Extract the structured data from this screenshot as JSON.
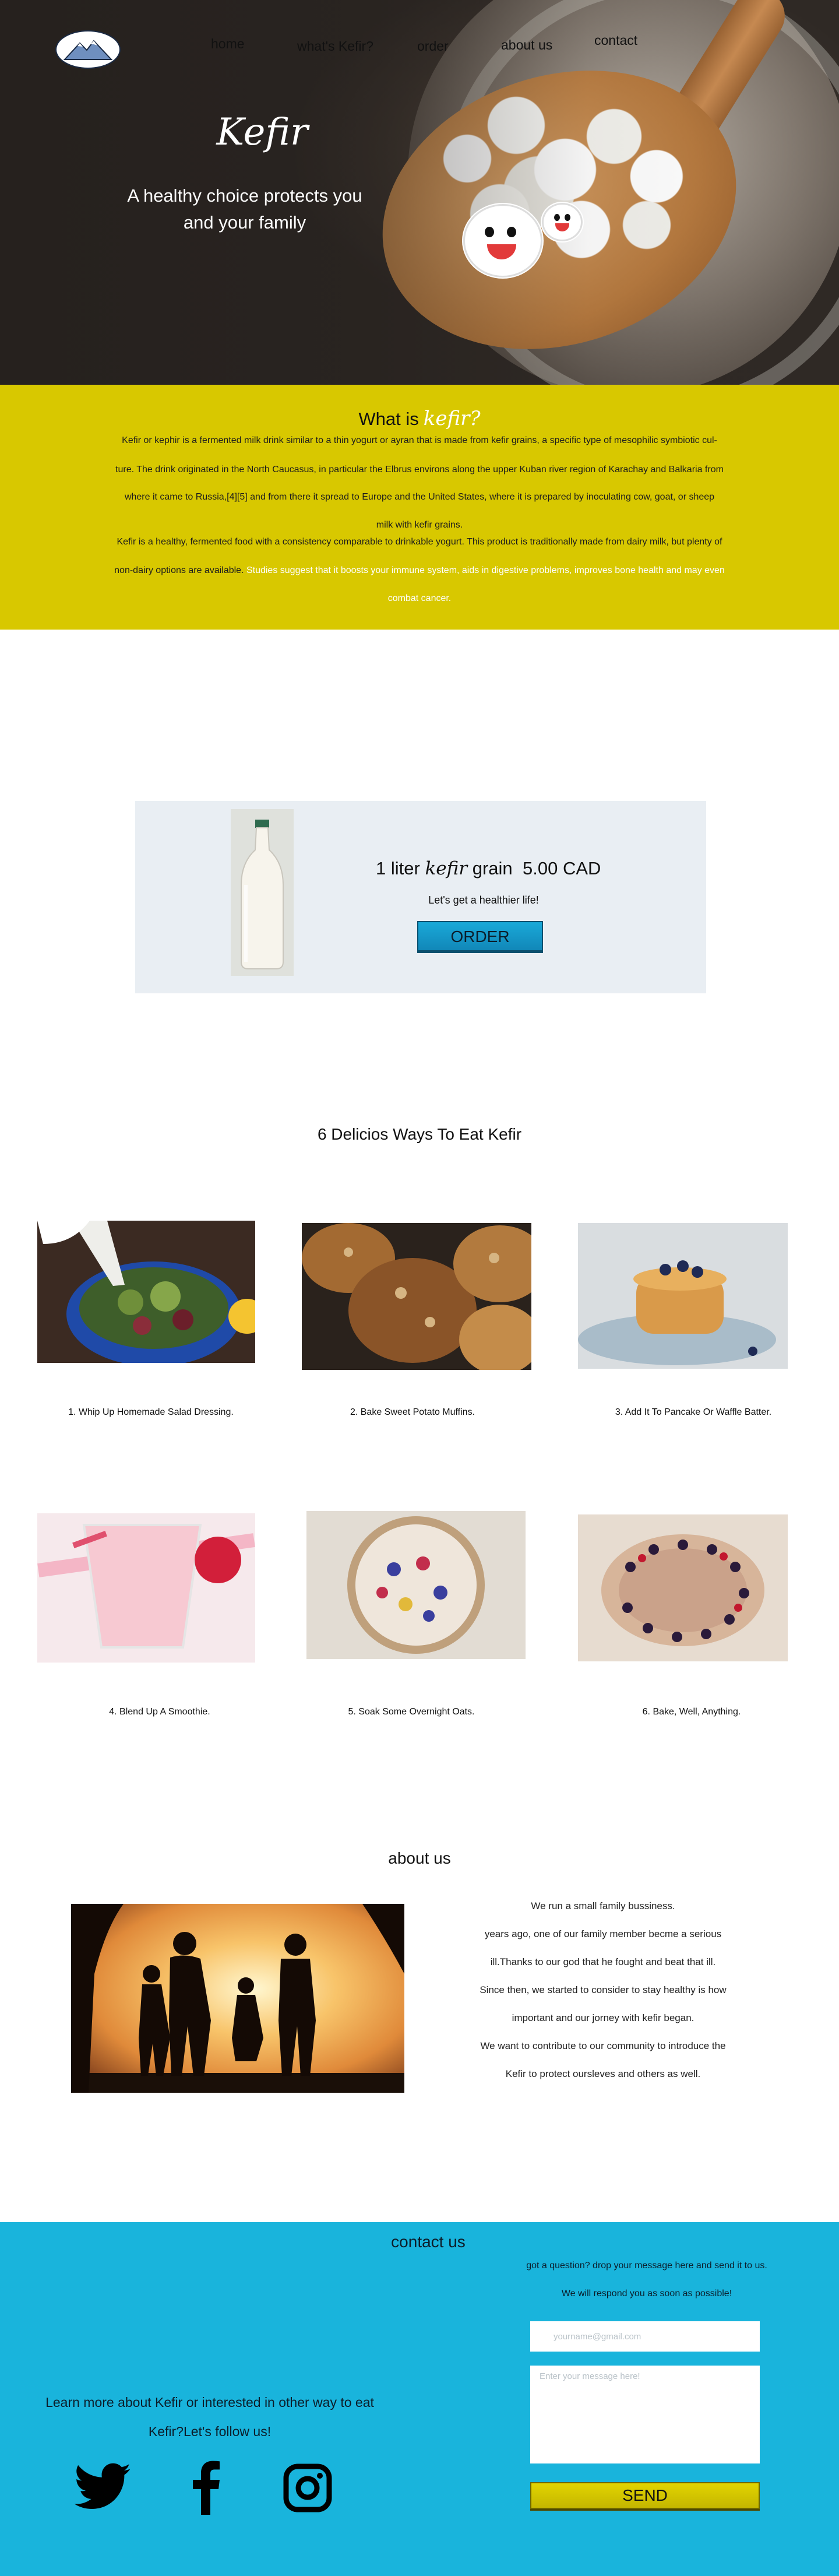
{
  "nav": {
    "items": [
      {
        "label": "home"
      },
      {
        "label": "what's Kefir?"
      },
      {
        "label": "order"
      },
      {
        "label": "about us"
      },
      {
        "label": "contact"
      }
    ]
  },
  "hero": {
    "title": "Kefir",
    "subtitle_line1": "A healthy choice protects you",
    "subtitle_line2": "and your family"
  },
  "whatis": {
    "title": "What is",
    "title_highlight": "kefir?",
    "lines": [
      "Kefir or kephir is a fermented milk drink similar to a thin yogurt or ayran that is made from kefir grains, a specific type of mesophilic symbiotic cul-",
      "ture. The drink originated in the North Caucasus, in particular the Elbrus environs along the upper Kuban river region of Karachay and Balkaria from",
      "where it came to Russia,[4][5] and from there it spread to Europe and the United States, where it is prepared by inoculating cow, goat, or sheep",
      "milk with kefir grains.",
      "Kefir is a healthy, fermented food with a consistency comparable to drinkable yogurt. This product is traditionally made from dairy milk, but plenty of"
    ],
    "line6_plain": "non-dairy options are available.",
    "line6_highlight": " Studies suggest that it boosts your immune system, aids in digestive problems, improves bone health and may even",
    "line7_highlight": "combat cancer."
  },
  "product": {
    "name_prefix": "1 liter",
    "name_kefir": "kefir",
    "name_suffix": "grain",
    "price": "5.00 CAD",
    "tagline": "Let's get a healthier life!",
    "order_label": "ORDER"
  },
  "recipes": {
    "title": "6 Delicios Ways To Eat Kefir",
    "items": [
      {
        "caption": "1. Whip Up Homemade Salad Dressing."
      },
      {
        "caption": "2. Bake Sweet Potato Muffins."
      },
      {
        "caption": "3. Add It To Pancake Or Waffle Batter."
      },
      {
        "caption": "4. Blend Up A Smoothie."
      },
      {
        "caption": "5. Soak Some Overnight Oats."
      },
      {
        "caption": "6. Bake, Well, Anything."
      }
    ]
  },
  "about": {
    "title": "about us",
    "lines": [
      "We run a small family bussiness.",
      "years ago, one of our family member becme a serious",
      "ill.Thanks to our god that he fought and beat that ill.",
      "Since then, we started to consider to stay healthy is how",
      "important and our jorney with kefir began.",
      "We want to contribute to our community to introduce the",
      "Kefir to protect oursleves and others as well."
    ]
  },
  "contact": {
    "title": "contact us",
    "question": "got a question? drop your message here and send it to us.",
    "respond": "We will respond you as soon as possible!",
    "email_placeholder": "yourname@gmail.com",
    "message_placeholder": "Enter your message here!",
    "send_label": "SEND",
    "follow_line1": "Learn more about Kefir or interested in other way to eat",
    "follow_line2": "Kefir?Let's follow us!"
  },
  "colors": {
    "yellow_band": "#d8c800",
    "contact_bg": "#19b4dc",
    "order_button": "#1aa9d8",
    "send_button": "#d8c800",
    "product_panel": "#e9eef3"
  },
  "icons": {
    "logo": "mountain-logo-icon",
    "social": [
      "twitter-icon",
      "facebook-icon",
      "instagram-icon"
    ]
  }
}
